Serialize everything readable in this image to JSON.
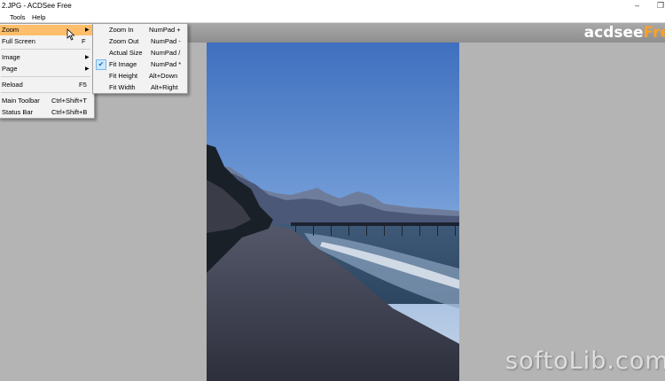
{
  "window": {
    "title": "2.JPG - ACDSee Free",
    "minimize_glyph": "–",
    "restore_glyph": "❐"
  },
  "menubar": {
    "items": [
      {
        "label": "Tools"
      },
      {
        "label": "Help"
      }
    ]
  },
  "logo": {
    "main": "acdsee",
    "accent": "Fre"
  },
  "view_menu": {
    "items": [
      {
        "label": "Zoom",
        "shortcut": ""
      },
      {
        "label": "Full Screen",
        "shortcut": "F"
      },
      {
        "label": "Image",
        "shortcut": ""
      },
      {
        "label": "Page",
        "shortcut": ""
      },
      {
        "label": "Reload",
        "shortcut": "F5"
      },
      {
        "label": "Main Toolbar",
        "shortcut": "Ctrl+Shift+T"
      },
      {
        "label": "Status Bar",
        "shortcut": "Ctrl+Shift+B"
      }
    ]
  },
  "zoom_menu": {
    "items": [
      {
        "label": "Zoom In",
        "shortcut": "NumPad +"
      },
      {
        "label": "Zoom Out",
        "shortcut": "NumPad -"
      },
      {
        "label": "Actual Size",
        "shortcut": "NumPad /"
      },
      {
        "label": "Fit Image",
        "shortcut": "NumPad *",
        "checked": true
      },
      {
        "label": "Fit Height",
        "shortcut": "Alt+Down"
      },
      {
        "label": "Fit Width",
        "shortcut": "Alt+Right"
      }
    ]
  },
  "watermark": "softoLib.com",
  "colors": {
    "menu_highlight": "#ffbe6b",
    "logo_accent": "#f7a12b",
    "viewer_bg": "#b4b4b4"
  }
}
